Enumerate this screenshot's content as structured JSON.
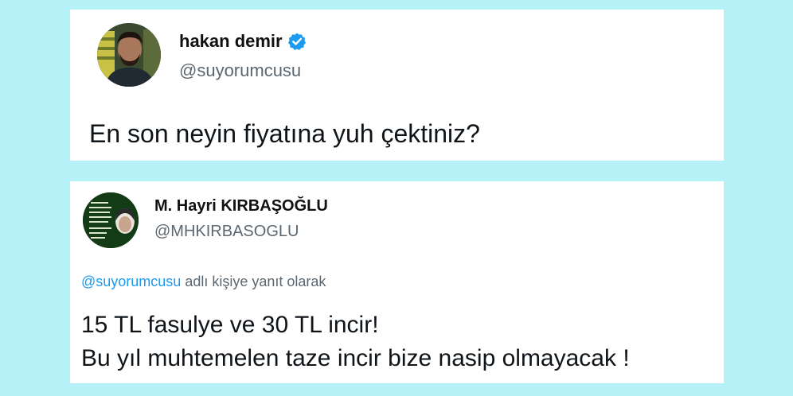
{
  "colors": {
    "background": "#b5f1f7",
    "card": "#ffffff",
    "text": "#0f1419",
    "muted": "#5b6770",
    "link": "#1d9bf0",
    "verified": "#1d9bf0"
  },
  "tweet1": {
    "author_name": "hakan demir",
    "handle": "@suyorumcusu",
    "verified": true,
    "avatar_icon": "profile-photo-man",
    "text": "En son neyin fiyatına yuh çektiniz?"
  },
  "tweet2": {
    "author_name": "M. Hayri KIRBAŞOĞLU",
    "handle": "@MHKIRBASOGLU",
    "avatar_icon": "profile-photo-green-text",
    "reply_to_handle": "@suyorumcusu",
    "reply_suffix": " adlı kişiye yanıt olarak",
    "text_lines": [
      "15 TL fasulye ve 30 TL incir!",
      "Bu yıl muhtemelen taze incir bize nasip olmayacak !"
    ]
  }
}
